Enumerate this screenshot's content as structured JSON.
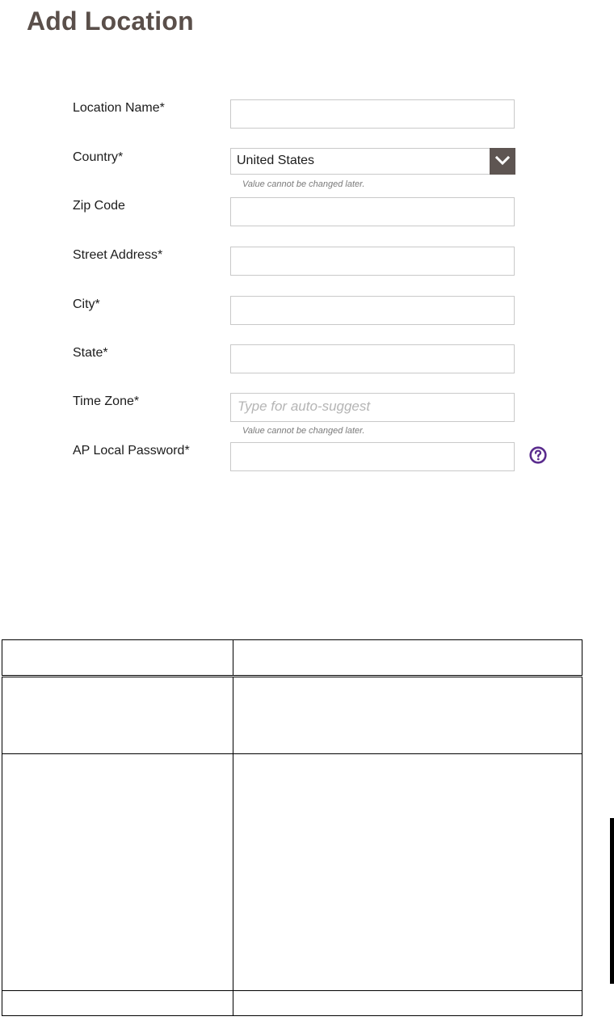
{
  "page": {
    "title": "Add Location"
  },
  "form": {
    "location_name": {
      "label": "Location Name*",
      "value": ""
    },
    "country": {
      "label": "Country*",
      "value": "United States",
      "hint": "Value cannot be changed later."
    },
    "zip_code": {
      "label": "Zip Code",
      "value": ""
    },
    "street_address": {
      "label": "Street Address*",
      "value": ""
    },
    "city": {
      "label": "City*",
      "value": ""
    },
    "state": {
      "label": "State*",
      "value": ""
    },
    "time_zone": {
      "label": "Time Zone*",
      "value": "",
      "placeholder": "Type for auto-suggest",
      "hint": "Value cannot be changed later."
    },
    "ap_password": {
      "label": "AP Local Password*",
      "value": ""
    }
  },
  "icons": {
    "country_dropdown": "chevron-down-icon",
    "help": "question-circle-icon"
  },
  "colors": {
    "title": "#5a4f4a",
    "dropdown_button": "#5e5552",
    "help_icon": "#5b2d8e"
  }
}
